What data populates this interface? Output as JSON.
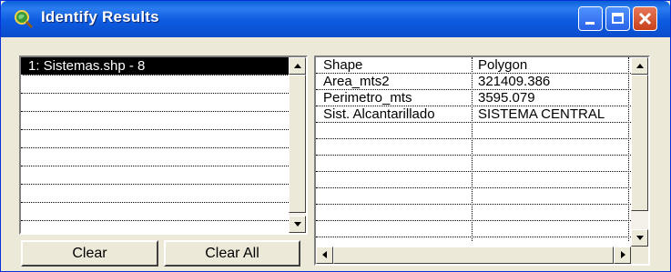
{
  "window": {
    "title": "Identify Results",
    "icon": "magnifier-globe-icon"
  },
  "title_buttons": {
    "minimize": "minimize-icon",
    "maximize": "maximize-icon",
    "close": "close-icon"
  },
  "results_list": {
    "items": [
      {
        "label": "1:  Sistemas.shp - 8",
        "selected": true
      },
      {
        "label": ""
      },
      {
        "label": ""
      },
      {
        "label": ""
      },
      {
        "label": ""
      },
      {
        "label": ""
      },
      {
        "label": ""
      },
      {
        "label": ""
      },
      {
        "label": ""
      }
    ]
  },
  "attributes": {
    "rows": [
      {
        "field": "Shape",
        "value": "Polygon"
      },
      {
        "field": "Area_mts2",
        "value": "321409.386"
      },
      {
        "field": "Perimetro_mts",
        "value": "3595.079"
      },
      {
        "field": "Sist. Alcantarillado",
        "value": "SISTEMA CENTRAL"
      },
      {
        "field": "",
        "value": ""
      },
      {
        "field": "",
        "value": ""
      },
      {
        "field": "",
        "value": ""
      },
      {
        "field": "",
        "value": ""
      },
      {
        "field": "",
        "value": ""
      },
      {
        "field": "",
        "value": ""
      },
      {
        "field": "",
        "value": ""
      }
    ]
  },
  "buttons": {
    "clear": "Clear",
    "clear_all": "Clear All"
  },
  "colors": {
    "titlebar": "#0a5fd8",
    "face": "#ece9d8",
    "selection": "#000000"
  }
}
